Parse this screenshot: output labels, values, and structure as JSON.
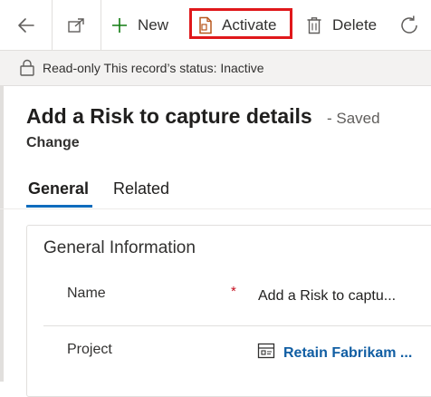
{
  "toolbar": {
    "back_icon": "arrow-left-icon",
    "popout_icon": "open-in-new-window-icon",
    "new_label": "New",
    "new_icon": "plus-icon",
    "activate_label": "Activate",
    "activate_icon": "document-icon",
    "delete_label": "Delete",
    "delete_icon": "trash-icon",
    "refresh_icon": "refresh-icon",
    "highlight_color": "#e0181b"
  },
  "notice": {
    "icon": "lock-icon",
    "text": "Read-only This record’s status: Inactive"
  },
  "header": {
    "title": "Add a Risk to capture details",
    "save_status": "- Saved",
    "entity": "Change"
  },
  "tabs": [
    {
      "label": "General",
      "selected": true
    },
    {
      "label": "Related",
      "selected": false
    }
  ],
  "section": {
    "title": "General Information",
    "fields": [
      {
        "label": "Name",
        "required": "*",
        "value": "Add a Risk to captu..."
      },
      {
        "label": "Project",
        "value": "Retain Fabrikam ...",
        "icon": "lookup-record-icon"
      }
    ]
  },
  "colors": {
    "accent": "#0f6cbd",
    "link": "#115ea3",
    "required": "#c50f1f",
    "new_icon": "#107c10"
  }
}
